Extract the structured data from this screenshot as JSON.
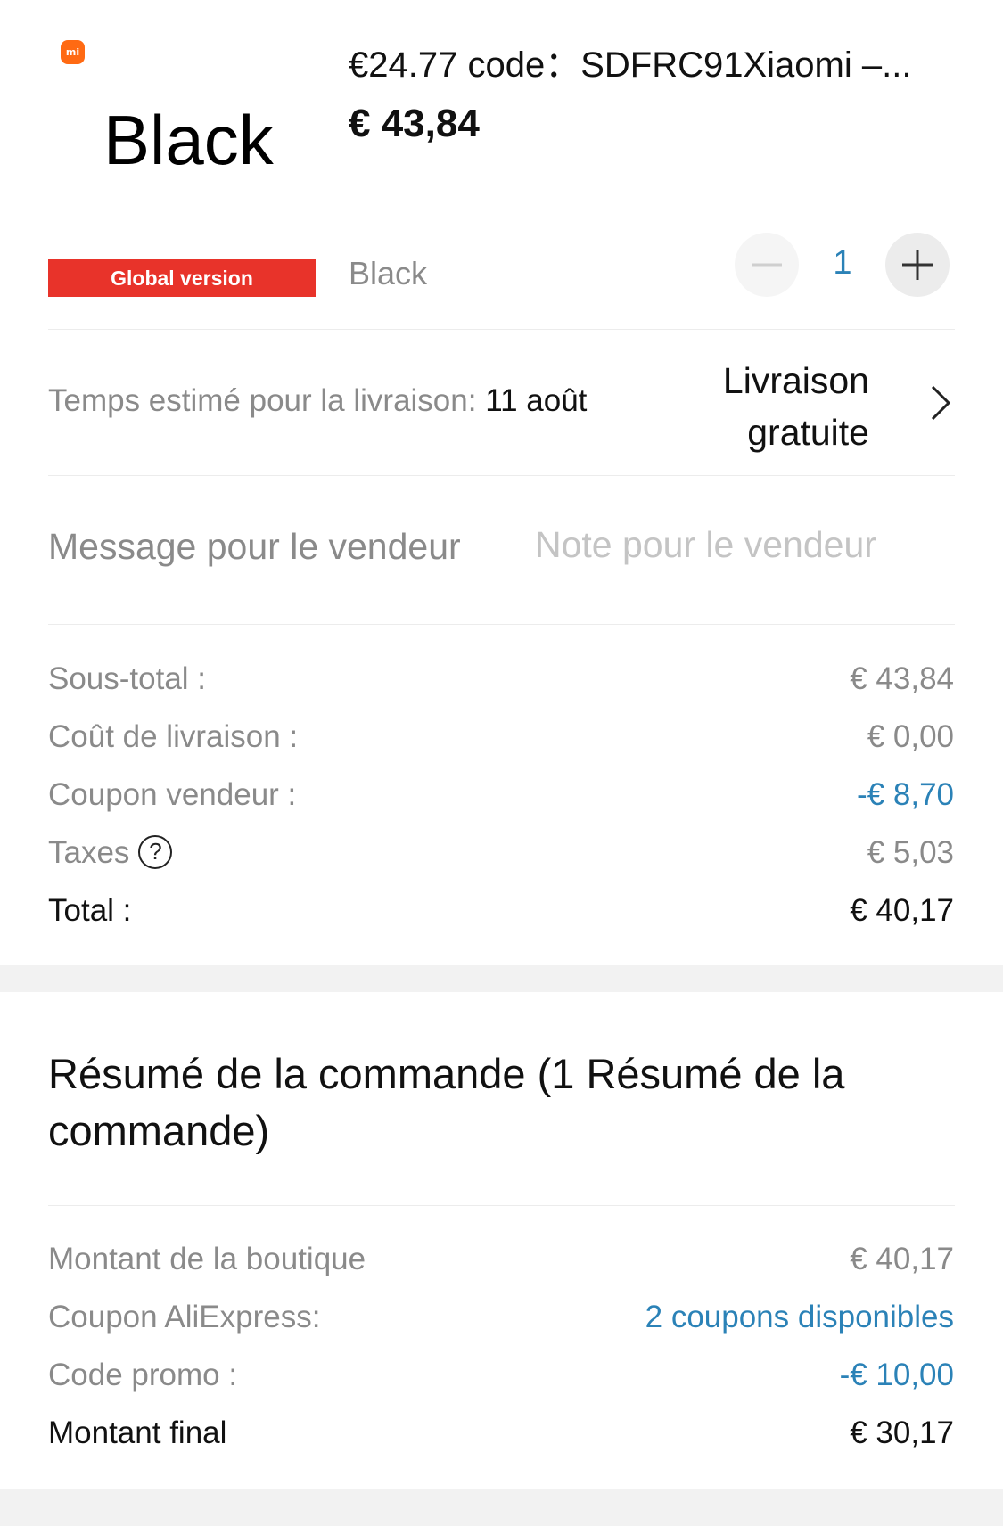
{
  "product": {
    "logo_text": "mi",
    "image_label": "Black",
    "title": "€24.77 code：SDFRC91Xiaomi –...",
    "price": "€ 43,84",
    "badge": "Global version",
    "variant": "Black",
    "quantity": "1"
  },
  "delivery": {
    "label": "Temps estimé pour la livraison: ",
    "date": "11 août",
    "shipping": "Livraison gratuite"
  },
  "message": {
    "label": "Message pour le vendeur",
    "placeholder": "Note pour le vendeur"
  },
  "totals": {
    "subtotal_label": "Sous-total :",
    "subtotal_value": "€ 43,84",
    "shipping_label": "Coût de livraison :",
    "shipping_value": "€ 0,00",
    "coupon_label": "Coupon vendeur :",
    "coupon_value": "-€ 8,70",
    "taxes_label": "Taxes",
    "taxes_value": "€ 5,03",
    "total_label": "Total :",
    "total_value": "€ 40,17"
  },
  "summary": {
    "title": "Résumé de la commande (1 Résumé de la commande)",
    "shop_amount_label": "Montant de la boutique",
    "shop_amount_value": "€ 40,17",
    "aliexpress_coupon_label": "Coupon AliExpress:",
    "aliexpress_coupon_value": "2 coupons disponibles",
    "promo_label": "Code promo :",
    "promo_value": "-€ 10,00",
    "final_label": "Montant final",
    "final_value": "€ 30,17"
  },
  "colors": {
    "accent_blue": "#2b82b7",
    "badge_red": "#e8332a",
    "brand_orange": "#ff6a13"
  }
}
